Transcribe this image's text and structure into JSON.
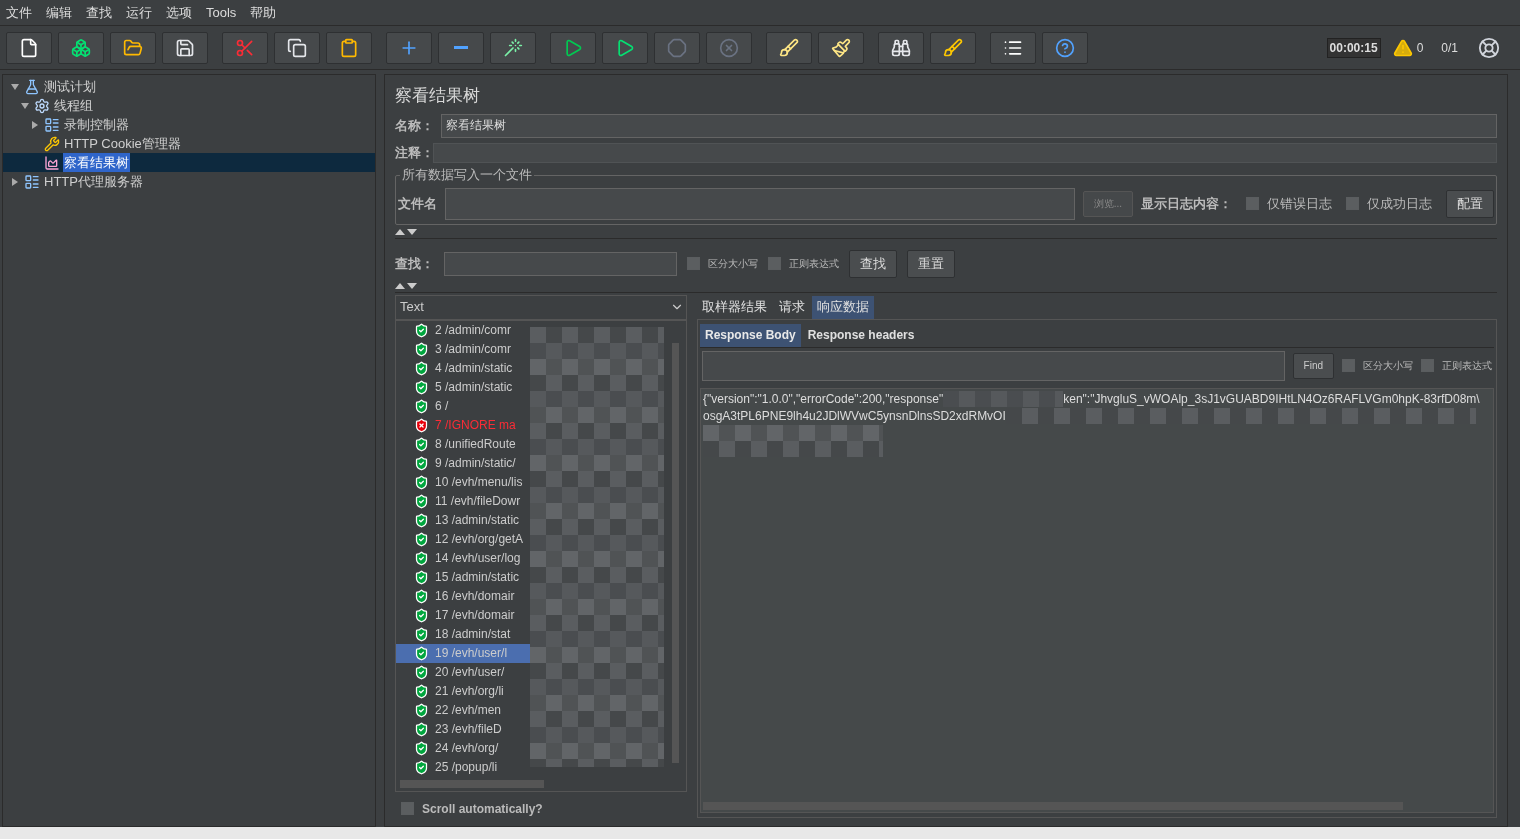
{
  "menu": [
    "文件",
    "编辑",
    "查找",
    "运行",
    "选项",
    "Tools",
    "帮助"
  ],
  "status": {
    "timer": "00:00:15",
    "warnings": "0",
    "threads": "0/1"
  },
  "tree": [
    {
      "label": "测试计划",
      "kind": "plan",
      "expanded": true,
      "selected": false,
      "children": [
        {
          "label": "线程组",
          "kind": "threads",
          "expanded": true,
          "selected": false,
          "children": [
            {
              "label": "录制控制器",
              "kind": "controller",
              "expanded": false,
              "selected": false
            },
            {
              "label": "HTTP Cookie管理器",
              "kind": "config",
              "selected": false
            },
            {
              "label": "察看结果树",
              "kind": "listener",
              "selected": true
            }
          ]
        }
      ]
    },
    {
      "label": "HTTP代理服务器",
      "kind": "controller",
      "expanded": false,
      "selected": false
    }
  ],
  "panel": {
    "title": "察看结果树",
    "name_label": "名称：",
    "name_value": "察看结果树",
    "comment_label": "注释：",
    "file_group": "所有数据写入一个文件",
    "file_label": "文件名",
    "browse": "浏览...",
    "log_label": "显示日志内容：",
    "log_options": [
      {
        "label": "仅错误日志",
        "checked": false
      },
      {
        "label": "仅成功日志",
        "checked": false
      }
    ],
    "configure": "配置",
    "search_label": "查找：",
    "search_options": [
      {
        "label": "区分大小写",
        "checked": false
      },
      {
        "label": "正则表达式",
        "checked": false
      }
    ],
    "search_button": "查找",
    "reset_button": "重置"
  },
  "results": {
    "renderer": "Text",
    "scroll_auto": {
      "label": "Scroll automatically?",
      "checked": false
    },
    "items": [
      {
        "text": "2 /admin/comr",
        "kind": "ok",
        "selected": false
      },
      {
        "text": "3 /admin/comr",
        "kind": "ok",
        "selected": false
      },
      {
        "text": "4 /admin/static",
        "kind": "ok",
        "selected": false
      },
      {
        "text": "5 /admin/static",
        "kind": "ok",
        "selected": false
      },
      {
        "text": "6 /",
        "kind": "ok",
        "selected": false
      },
      {
        "text": "7 /IGNORE ma",
        "kind": "error",
        "selected": false
      },
      {
        "text": "8 /unifiedRoute",
        "kind": "ok",
        "selected": false
      },
      {
        "text": "9 /admin/static/",
        "kind": "ok",
        "selected": false
      },
      {
        "text": "10 /evh/menu/lis",
        "kind": "ok",
        "selected": false
      },
      {
        "text": "11 /evh/fileDowr",
        "kind": "ok",
        "selected": false
      },
      {
        "text": "13 /admin/static",
        "kind": "ok",
        "selected": false
      },
      {
        "text": "12 /evh/org/getA",
        "kind": "ok",
        "selected": false
      },
      {
        "text": "14 /evh/user/log",
        "kind": "ok",
        "selected": false
      },
      {
        "text": "15 /admin/static",
        "kind": "ok",
        "selected": false
      },
      {
        "text": "16 /evh/domair",
        "kind": "ok",
        "selected": false
      },
      {
        "text": "17 /evh/domair",
        "kind": "ok",
        "selected": false
      },
      {
        "text": "18 /admin/stat",
        "kind": "ok",
        "selected": false
      },
      {
        "text": "19 /evh/user/l",
        "kind": "ok",
        "selected": true
      },
      {
        "text": "20 /evh/user/",
        "kind": "ok",
        "selected": false
      },
      {
        "text": "21 /evh/org/li",
        "kind": "ok",
        "selected": false
      },
      {
        "text": "22 /evh/men",
        "kind": "ok",
        "selected": false
      },
      {
        "text": "23 /evh/fileD",
        "kind": "ok",
        "selected": false
      },
      {
        "text": "24 /evh/org/",
        "kind": "ok",
        "selected": false
      },
      {
        "text": "25 /popup/li",
        "kind": "ok",
        "selected": false
      }
    ]
  },
  "detail": {
    "tabs": [
      {
        "label": "取样器结果",
        "selected": false
      },
      {
        "label": "请求",
        "selected": false
      },
      {
        "label": "响应数据",
        "selected": true
      }
    ],
    "subtabs": [
      {
        "label": "Response Body",
        "selected": true
      },
      {
        "label": "Response headers",
        "selected": false
      }
    ],
    "find_button": "Find",
    "find_options": [
      {
        "label": "区分大小写",
        "checked": false
      },
      {
        "label": "正则表达式",
        "checked": false
      }
    ],
    "lines": [
      [
        "{\"version\":\"1.0.0\",\"errorCode\":200,\"response\"",
        "ken\":\"JhvgluS_vWOAlp_3sJ1vGUABD9IHtLN4Oz6RAFLVGm0hpK-83rfD08m\\"
      ],
      [
        "osgA3tPL6PNE9lh4u2JDlWVwC5ynsnDlnsSD2xdRMvOI"
      ]
    ]
  }
}
